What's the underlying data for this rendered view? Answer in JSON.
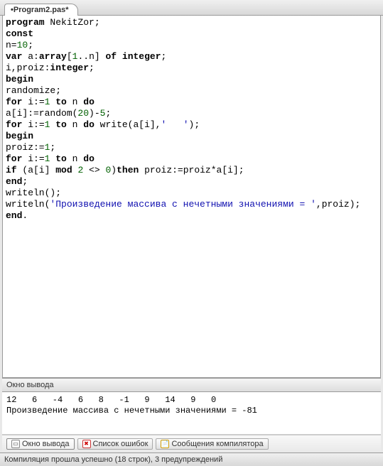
{
  "tab": {
    "label": "•Program2.pas*"
  },
  "code": {
    "lines": [
      [
        {
          "t": "program ",
          "c": "kw"
        },
        {
          "t": "NekitZor;",
          "c": ""
        }
      ],
      [
        {
          "t": "const",
          "c": "kw"
        }
      ],
      [
        {
          "t": "n=",
          "c": ""
        },
        {
          "t": "10",
          "c": "num"
        },
        {
          "t": ";",
          "c": ""
        }
      ],
      [
        {
          "t": "var ",
          "c": "kw"
        },
        {
          "t": "a:",
          "c": ""
        },
        {
          "t": "array",
          "c": "kw"
        },
        {
          "t": "[",
          "c": ""
        },
        {
          "t": "1",
          "c": "num"
        },
        {
          "t": "..n] ",
          "c": ""
        },
        {
          "t": "of ",
          "c": "kw"
        },
        {
          "t": "integer",
          "c": "type"
        },
        {
          "t": ";",
          "c": ""
        }
      ],
      [
        {
          "t": "i,proiz:",
          "c": ""
        },
        {
          "t": "integer",
          "c": "type"
        },
        {
          "t": ";",
          "c": ""
        }
      ],
      [
        {
          "t": "begin",
          "c": "kw"
        }
      ],
      [
        {
          "t": "randomize;",
          "c": ""
        }
      ],
      [
        {
          "t": "for ",
          "c": "kw"
        },
        {
          "t": "i:=",
          "c": ""
        },
        {
          "t": "1",
          "c": "num"
        },
        {
          "t": " ",
          "c": ""
        },
        {
          "t": "to ",
          "c": "kw"
        },
        {
          "t": "n ",
          "c": ""
        },
        {
          "t": "do",
          "c": "kw"
        }
      ],
      [
        {
          "t": "a[i]:=random(",
          "c": ""
        },
        {
          "t": "20",
          "c": "num"
        },
        {
          "t": ")-",
          "c": ""
        },
        {
          "t": "5",
          "c": "num"
        },
        {
          "t": ";",
          "c": ""
        }
      ],
      [
        {
          "t": "for ",
          "c": "kw"
        },
        {
          "t": "i:=",
          "c": ""
        },
        {
          "t": "1",
          "c": "num"
        },
        {
          "t": " ",
          "c": ""
        },
        {
          "t": "to ",
          "c": "kw"
        },
        {
          "t": "n ",
          "c": ""
        },
        {
          "t": "do ",
          "c": "kw"
        },
        {
          "t": "write(a[i],",
          "c": ""
        },
        {
          "t": "'   '",
          "c": "str"
        },
        {
          "t": ");",
          "c": ""
        }
      ],
      [
        {
          "t": "begin",
          "c": "kw"
        }
      ],
      [
        {
          "t": "proiz:=",
          "c": ""
        },
        {
          "t": "1",
          "c": "num"
        },
        {
          "t": ";",
          "c": ""
        }
      ],
      [
        {
          "t": "for ",
          "c": "kw"
        },
        {
          "t": "i:=",
          "c": ""
        },
        {
          "t": "1",
          "c": "num"
        },
        {
          "t": " ",
          "c": ""
        },
        {
          "t": "to ",
          "c": "kw"
        },
        {
          "t": "n ",
          "c": ""
        },
        {
          "t": "do",
          "c": "kw"
        }
      ],
      [
        {
          "t": "if ",
          "c": "kw"
        },
        {
          "t": "(a[i] ",
          "c": ""
        },
        {
          "t": "mod ",
          "c": "kw"
        },
        {
          "t": "2",
          "c": "num"
        },
        {
          "t": " <> ",
          "c": ""
        },
        {
          "t": "0",
          "c": "num"
        },
        {
          "t": ")",
          "c": ""
        },
        {
          "t": "then ",
          "c": "kw"
        },
        {
          "t": "proiz:=proiz*a[i];",
          "c": ""
        }
      ],
      [
        {
          "t": "end",
          "c": "kw"
        },
        {
          "t": ";",
          "c": ""
        }
      ],
      [
        {
          "t": "writeln();",
          "c": ""
        }
      ],
      [
        {
          "t": "writeln(",
          "c": ""
        },
        {
          "t": "'Произведение массива с нечетными значениями = '",
          "c": "str"
        },
        {
          "t": ",proiz);",
          "c": ""
        }
      ],
      [
        {
          "t": "end",
          "c": "kw"
        },
        {
          "t": ".",
          "c": ""
        }
      ]
    ]
  },
  "output": {
    "title": "Окно вывода",
    "lines": [
      "12   6   -4   6   8   -1   9   14   9   0   ",
      "Произведение массива с нечетными значениями = -81"
    ]
  },
  "bottom_tabs": {
    "items": [
      {
        "label": "Окно вывода",
        "active": true,
        "icon": ""
      },
      {
        "label": "Список ошибок",
        "active": false,
        "icon": "r"
      },
      {
        "label": "Сообщения компилятора",
        "active": false,
        "icon": "y"
      }
    ]
  },
  "status": {
    "text": "Компиляция прошла успешно (18 строк), 3 предупреждений"
  }
}
